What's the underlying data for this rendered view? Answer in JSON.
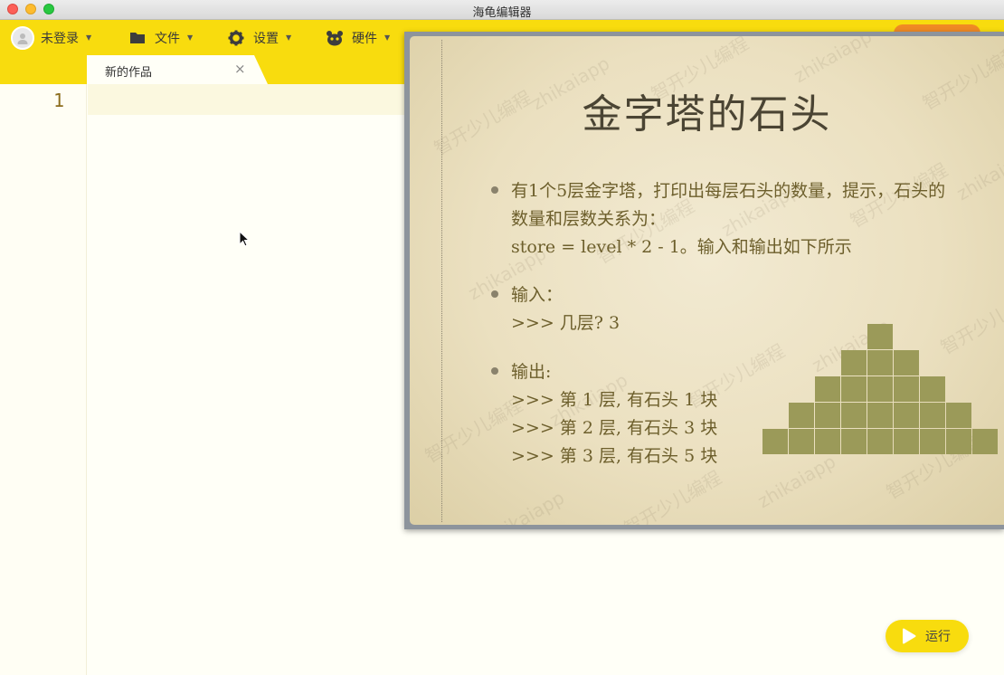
{
  "window": {
    "title": "海龟编辑器"
  },
  "toolbar": {
    "login_label": "未登录",
    "file_label": "文件",
    "settings_label": "设置",
    "hardware_label": "硬件"
  },
  "tabs": [
    {
      "label": "新的作品",
      "close": "×"
    }
  ],
  "editor": {
    "line_numbers": [
      "1"
    ]
  },
  "run_button": {
    "label": "运行"
  },
  "slide": {
    "title": "金字塔的石头",
    "bullets": [
      {
        "lines": [
          "有1个5层金字塔，打印出每层石头的数量，提示，石头的",
          "数量和层数关系为：",
          "store = level * 2 - 1。输入和输出如下所示"
        ]
      },
      {
        "lines": [
          "输入：",
          ">>> 几层? 3"
        ]
      },
      {
        "lines": [
          "输出:",
          ">>> 第 1 层, 有石头 1 块",
          ">>> 第 2 层, 有石头 3 块",
          ">>> 第 3 层, 有石头 5 块"
        ]
      }
    ],
    "watermark_text": [
      "智开少儿编程",
      "zhikaiapp"
    ],
    "pyramid_rows": [
      1,
      3,
      5,
      7,
      9
    ],
    "pyramid_color": "#9b9a59"
  },
  "colors": {
    "toolbar_bg": "#f8dc0e",
    "accent_orange": "#f08a24",
    "line_number": "#8c6d1d"
  }
}
